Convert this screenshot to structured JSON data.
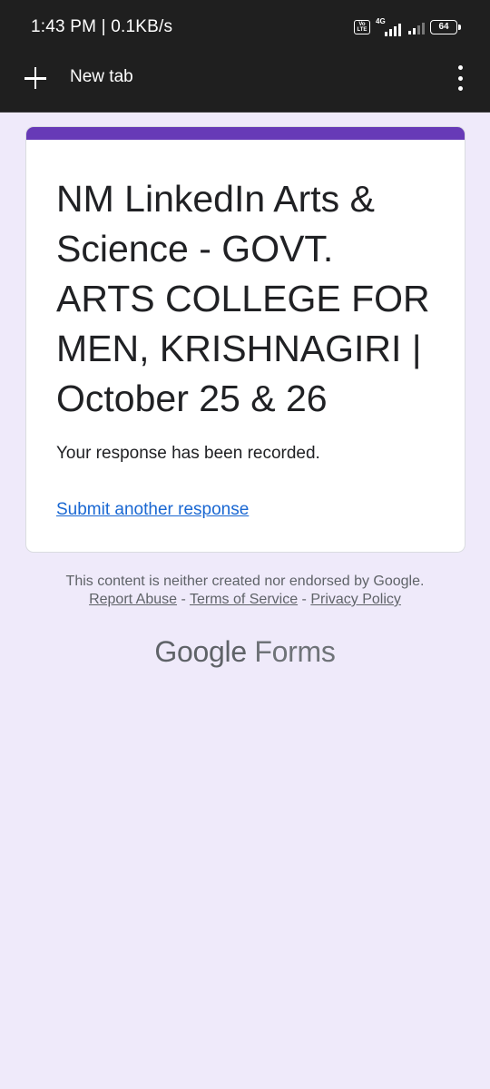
{
  "status_bar": {
    "time": "1:43 PM | 0.1KB/s",
    "volte": "Vo LTE",
    "network": "4G",
    "battery": "64"
  },
  "toolbar": {
    "new_tab_icon": "plus-icon",
    "tab_title": "New tab",
    "menu_icon": "more-vert-icon"
  },
  "form": {
    "accent_color": "#673ab7",
    "title": "NM LinkedIn Arts & Science - GOVT. ARTS COLLEGE FOR MEN, KRISHNAGIRI | October 25 & 26",
    "response_message": "Your response has been recorded.",
    "submit_another_label": "Submit another response"
  },
  "footer": {
    "disclaimer": "This content is neither created nor endorsed by Google.",
    "links": [
      "Report Abuse",
      "Terms of Service",
      "Privacy Policy"
    ],
    "separator": " - ",
    "brand_google": "Google",
    "brand_forms": "Forms"
  }
}
